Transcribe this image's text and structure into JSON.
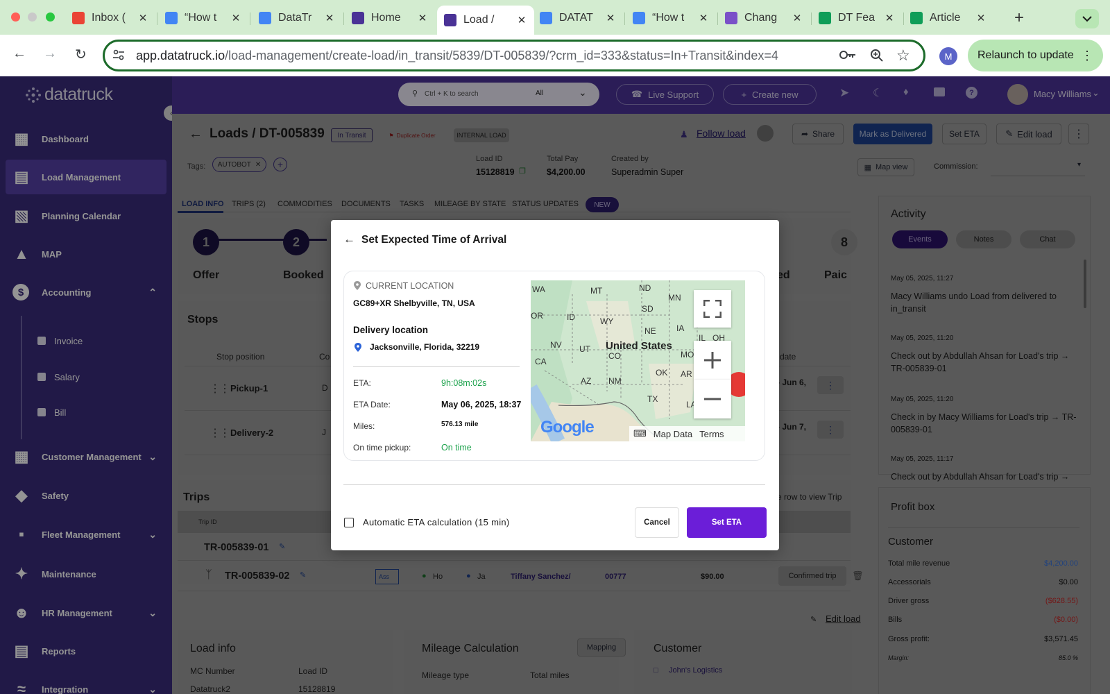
{
  "browser": {
    "tabs": [
      {
        "label": "Inbox (",
        "icon": "gmail-icon",
        "color": "#ea4335"
      },
      {
        "label": "“How t",
        "icon": "docs-icon",
        "color": "#4285f4"
      },
      {
        "label": "DataTr",
        "icon": "calendar-icon",
        "color": "#4285f4"
      },
      {
        "label": "Home",
        "icon": "app-logo-icon",
        "color": "#4a3296"
      },
      {
        "label": "Load /",
        "icon": "app-logo-icon",
        "color": "#4a3296"
      },
      {
        "label": "DATAT",
        "icon": "docs-icon",
        "color": "#4285f4"
      },
      {
        "label": "“How t",
        "icon": "docs-icon",
        "color": "#4285f4"
      },
      {
        "label": "Chang",
        "icon": "app-logo-icon",
        "color": "#7a50c8"
      },
      {
        "label": "DT Fea",
        "icon": "sheets-icon",
        "color": "#0f9d58"
      },
      {
        "label": "Article",
        "icon": "sheets-icon",
        "color": "#0f9d58"
      }
    ],
    "url_host": "app.datatruck.io",
    "url_path": "/load-management/create-load/in_transit/5839/DT-005839/?crm_id=333&status=In+Transit&index=4",
    "profile_initial": "M",
    "relaunch_label": "Relaunch to update"
  },
  "app": {
    "brand": "datatruck",
    "search_placeholder": "Ctrl + K to search",
    "search_scope": "All",
    "live_support": "Live Support",
    "create_new": "Create new",
    "user_name": "Macy Williams",
    "sidebar": [
      {
        "label": "Dashboard"
      },
      {
        "label": "Load Management"
      },
      {
        "label": "Planning Calendar"
      },
      {
        "label": "MAP"
      },
      {
        "label": "Accounting"
      },
      {
        "label": "Customer Management"
      },
      {
        "label": "Safety"
      },
      {
        "label": "Fleet Management"
      },
      {
        "label": "Maintenance"
      },
      {
        "label": "HR Management"
      },
      {
        "label": "Reports"
      },
      {
        "label": "Integration"
      }
    ],
    "accounting_sub": [
      "Invoice",
      "Salary",
      "Bill"
    ]
  },
  "load": {
    "title": "Loads / DT-005839",
    "status_badge": "In Transit",
    "duplicate_badge": "Duplicate Order",
    "internal_badge": "INTERNAL LOAD",
    "follow": "Follow load",
    "share": "Share",
    "mark_delivered": "Mark as Delivered",
    "set_eta": "Set ETA",
    "edit_load": "Edit load",
    "tags_label": "Tags:",
    "tag": "AUTOBOT",
    "load_id_label": "Load ID",
    "load_id": "15128819",
    "total_pay_label": "Total Pay",
    "total_pay": "$4,200.00",
    "created_by_label": "Created by",
    "created_by": "Superadmin Super",
    "map_view": "Map view",
    "commission_label": "Commission:",
    "tabs": [
      "LOAD INFO",
      "TRIPS (2)",
      "COMMODITIES",
      "DOCUMENTS",
      "TASKS",
      "MILEAGE BY STATE",
      "STATUS UPDATES"
    ],
    "new_badge": "NEW",
    "steps": [
      {
        "num": "1",
        "label": "Offer"
      },
      {
        "num": "2",
        "label": "Booked"
      },
      {
        "num": "8",
        "label": "Paic"
      }
    ],
    "step_partial": "ed",
    "stops_title": "Stops",
    "stop_position_header": "Stop position",
    "stop_co_header": "Co",
    "stop_date_header": "date",
    "stops": [
      {
        "name": "Pickup-1",
        "date": "- Jun 6,",
        "extra": "D"
      },
      {
        "name": "Delivery-2",
        "date": "- Jun 7,",
        "extra": "J"
      }
    ],
    "trips_title": "Trips",
    "trips_hint": "n the row to view Trip",
    "trip_id_header": "Trip ID",
    "trips": [
      {
        "id": "TR-005839-01"
      },
      {
        "id": "TR-005839-02",
        "badge": "Ass",
        "from": "Ho",
        "to": "Ja",
        "driver": "Tiffany Sanchez/",
        "unit": "00777",
        "amount": "$90.00",
        "status": "Confirmed trip"
      }
    ],
    "edit_load_link": "Edit load",
    "load_info_title": "Load info",
    "mc_label": "MC Number",
    "mc_value": "Datatruck2",
    "li_load_id_label": "Load ID",
    "li_load_id": "15128819",
    "mileage_title": "Mileage Calculation",
    "mapping_btn": "Mapping",
    "mileage_type": "Mileage type",
    "total_miles": "Total miles",
    "customer_title": "Customer",
    "customer_name": "John's Logistics"
  },
  "activity": {
    "title": "Activity",
    "tabs": [
      "Events",
      "Notes",
      "Chat"
    ],
    "events": [
      {
        "time": "May 05, 2025, 11:27",
        "text": "Macy Williams undo Load from delivered to in_transit"
      },
      {
        "time": "May 05, 2025, 11:20",
        "text": "Check out by Abdullah Ahsan for Load's trip → TR-005839-01"
      },
      {
        "time": "May 05, 2025, 11:20",
        "text": "Check in by Macy Williams for Load's trip → TR-005839-01"
      },
      {
        "time": "May 05, 2025, 11:17",
        "text": "Check out by Abdullah Ahsan for Load's trip →"
      }
    ]
  },
  "profit": {
    "title": "Profit box",
    "customer": "Customer",
    "rows": [
      {
        "label": "Total mile revenue",
        "value": "$4,200.00",
        "color": "#3a73d8"
      },
      {
        "label": "Accessorials",
        "value": "$0.00",
        "color": "#111111"
      },
      {
        "label": "Driver gross",
        "value": "($628.55)",
        "color": "#c62828"
      },
      {
        "label": "Bills",
        "value": "($0.00)",
        "color": "#c62828"
      },
      {
        "label": "Gross profit:",
        "value": "$3,571.45",
        "color": "#111111"
      },
      {
        "label": "Margin:",
        "value": "85.0 %",
        "color": "#111111"
      }
    ]
  },
  "modal": {
    "title": "Set Expected Time of Arrival",
    "current_location_label": "CURRENT LOCATION",
    "current_location": "GC89+XR Shelbyville, TN, USA",
    "delivery_label": "Delivery location",
    "delivery_location": "Jacksonville, Florida, 32219",
    "eta_label": "ETA:",
    "eta_value": "9h:08m:02s",
    "eta_date_label": "ETA Date:",
    "eta_date": "May 06, 2025, 18:37",
    "miles_label": "Miles:",
    "miles": "576.13 mile",
    "on_time_label": "On time pickup:",
    "on_time": "On time",
    "auto_eta_label": "Automatic ETA calculation (15 min)",
    "auto_eta_checked": false,
    "cancel": "Cancel",
    "set_eta": "Set ETA",
    "map": {
      "country": "United States",
      "states": [
        "WA",
        "MT",
        "ND",
        "MN",
        "OR",
        "ID",
        "SD",
        "WY",
        "NE",
        "IA",
        "IL",
        "OH",
        "NV",
        "UT",
        "CO",
        "MO",
        "CA",
        "AZ",
        "NM",
        "OK",
        "AR",
        "TX",
        "LA"
      ],
      "logo": "Google",
      "map_data": "Map Data",
      "terms": "Terms"
    }
  }
}
